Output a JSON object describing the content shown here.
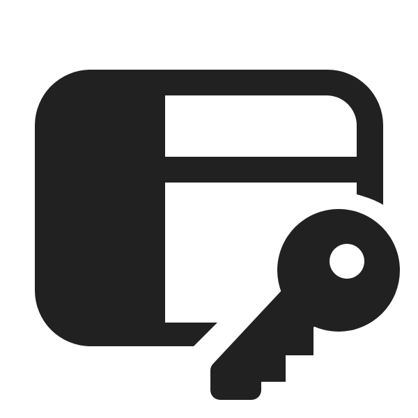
{
  "icon": {
    "name": "window-key-icon",
    "parts": [
      "window-frame",
      "window-sidebar",
      "window-title-bar",
      "key"
    ]
  },
  "colors": {
    "background": "#ffffff",
    "glyph": "#212121"
  }
}
